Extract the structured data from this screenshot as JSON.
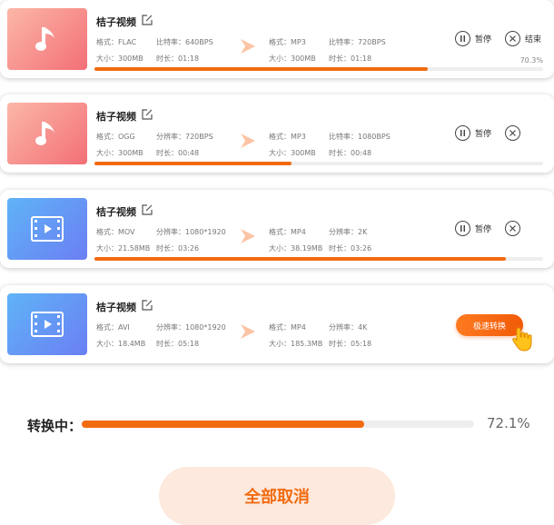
{
  "tasks": [
    {
      "name": "桔子视频",
      "kind": "audio",
      "src": {
        "format": "格式：FLAC",
        "rate": "比特率：640BPS",
        "size": "大小：300MB",
        "duration": "时长：01:18"
      },
      "dst": {
        "format": "格式：MP3",
        "rate": "比特率：720BPS",
        "size": "大小：300MB",
        "duration": "时长：01:18"
      },
      "progress": 0.743,
      "pause_label": "暂停",
      "end_label": "结束",
      "percent": "70.3%"
    },
    {
      "name": "桔子视频",
      "kind": "audio",
      "src": {
        "format": "格式：OGG",
        "rate": "分辨率：720BPS",
        "size": "大小：300MB",
        "duration": "时长：00:48"
      },
      "dst": {
        "format": "格式：MP3",
        "rate": "比特率：1080BPS",
        "size": "大小：300MB",
        "duration": "时长：00:48"
      },
      "progress": 0.44,
      "pause_label": "暂停"
    },
    {
      "name": "桔子视频",
      "kind": "video",
      "src": {
        "format": "格式：MOV",
        "rate": "分辨率：1080*1920",
        "size": "大小：21.58MB",
        "duration": "时长：03:26"
      },
      "dst": {
        "format": "格式：MP4",
        "rate": "分辨率：2K",
        "size": "大小：38.19MB",
        "duration": "时长：03:26"
      },
      "progress": 0.917,
      "pause_label": "暂停"
    },
    {
      "name": "桔子视频",
      "kind": "video",
      "src": {
        "format": "格式：AVI",
        "rate": "分辨率：1080*1920",
        "size": "大小：18.4MB",
        "duration": "时长：05:18"
      },
      "dst": {
        "format": "格式：MP4",
        "rate": "分辨率：4K",
        "size": "大小：185.3MB",
        "duration": "时长：05:18"
      },
      "fast_label": "极速转换"
    }
  ],
  "overall": {
    "label": "转换中：",
    "percent": "72.1%",
    "progress": 0.721
  },
  "cancel_all_label": "全部取消",
  "colors": {
    "accent": "#f26b10",
    "cancel_bg": "#fde9dd"
  },
  "icons": {
    "audio": "music-note-icon",
    "video": "film-icon",
    "edit": "edit-icon",
    "arrow": "arrow-right-icon",
    "pause": "pause-icon",
    "close": "close-icon",
    "cursor": "hand-cursor-icon"
  }
}
